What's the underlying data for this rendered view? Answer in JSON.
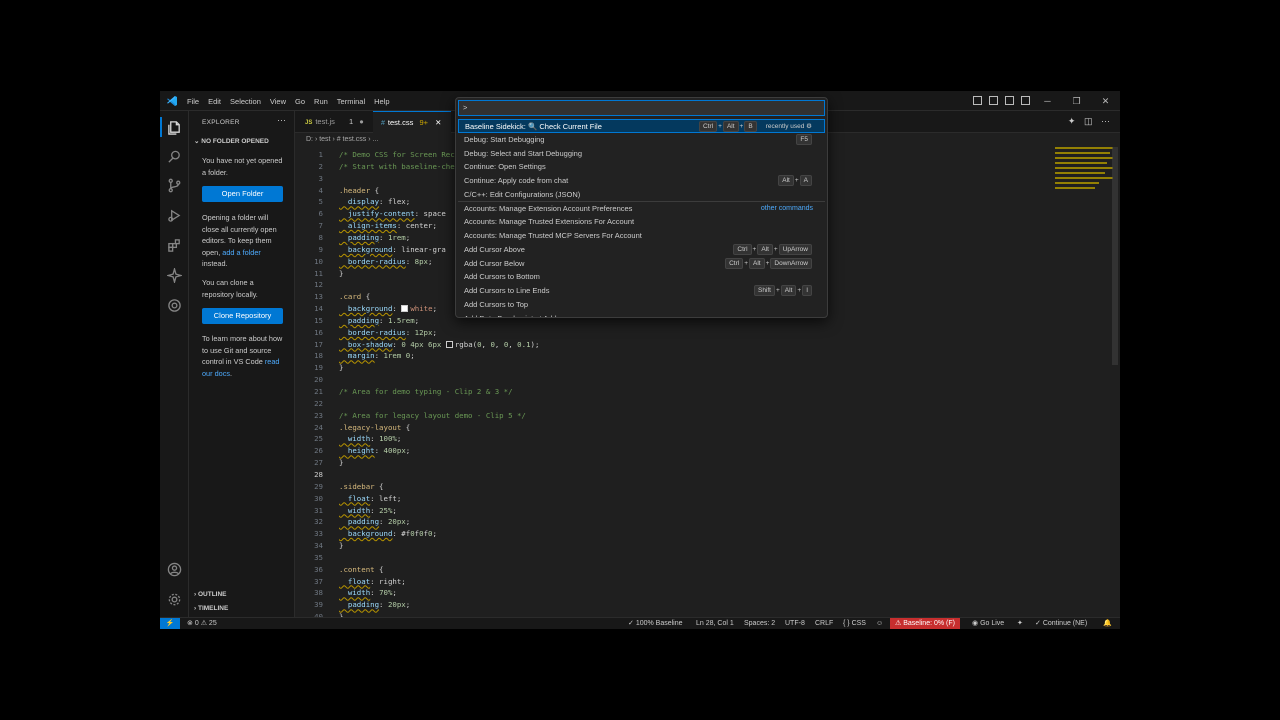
{
  "menu": [
    "File",
    "Edit",
    "Selection",
    "View",
    "Go",
    "Run",
    "Terminal",
    "Help"
  ],
  "sidebar": {
    "title": "EXPLORER",
    "section": "NO FOLDER OPENED",
    "msg1": "You have not yet opened a folder.",
    "open_folder": "Open Folder",
    "msg2_pre": "Opening a folder will close all currently open editors. To keep them open, ",
    "msg2_link": "add a folder",
    "msg2_post": " instead.",
    "msg3": "You can clone a repository locally.",
    "clone": "Clone Repository",
    "msg4_pre": "To learn more about how to use Git and source control in VS Code ",
    "msg4_link": "read our docs",
    "msg4_post": ".",
    "outline": "OUTLINE",
    "timeline": "TIMELINE"
  },
  "tabs": [
    {
      "icon": "JS",
      "name": "test.js",
      "badge": "1"
    },
    {
      "icon": "#",
      "name": "test.css",
      "badge": "9+"
    }
  ],
  "breadcrumb": "D: › test › # test.css › ...",
  "palette": {
    "input": ">",
    "items": [
      {
        "label": "Baseline Sidekick: 🔍 Check Current File",
        "keys": [
          "Ctrl",
          "+",
          "Alt",
          "+",
          "B"
        ],
        "right": "recently used"
      },
      {
        "label": "Debug: Start Debugging",
        "keys": [
          "F5"
        ]
      },
      {
        "label": "Debug: Select and Start Debugging"
      },
      {
        "label": "Continue: Open Settings"
      },
      {
        "label": "Continue: Apply code from chat",
        "keys": [
          "Alt",
          "+",
          "A"
        ]
      },
      {
        "label": "C/C++: Edit Configurations (JSON)"
      },
      {
        "label": "Accounts: Manage Extension Account Preferences",
        "link": "other commands"
      },
      {
        "label": "Accounts: Manage Trusted Extensions For Account"
      },
      {
        "label": "Accounts: Manage Trusted MCP Servers For Account"
      },
      {
        "label": "Add Cursor Above",
        "keys": [
          "Ctrl",
          "+",
          "Alt",
          "+",
          "UpArrow"
        ]
      },
      {
        "label": "Add Cursor Below",
        "keys": [
          "Ctrl",
          "+",
          "Alt",
          "+",
          "DownArrow"
        ]
      },
      {
        "label": "Add Cursors to Bottom"
      },
      {
        "label": "Add Cursors to Line Ends",
        "keys": [
          "Shift",
          "+",
          "Alt",
          "+",
          "I"
        ]
      },
      {
        "label": "Add Cursors to Top"
      },
      {
        "label": "Add Data Breakpoint at Address"
      }
    ]
  },
  "code": [
    "/* Demo CSS for Screen Recording",
    "/* Start with baseline-check",
    "",
    ".header {",
    "  display: flex;",
    "  justify-content: space",
    "  align-items: center;",
    "  padding: 1rem;",
    "  background: linear-gra",
    "  border-radius: 8px;",
    "}",
    "",
    ".card {",
    "  background: white;",
    "  padding: 1.5rem;",
    "  border-radius: 12px;",
    "  box-shadow: 0 4px 6px rgba(0, 0, 0, 0.1);",
    "  margin: 1rem 0;",
    "}",
    "",
    "/* Area for demo typing - Clip 2 & 3 */",
    "",
    "/* Area for legacy layout demo - Clip 5 */",
    ".legacy-layout {",
    "  width: 100%;",
    "  height: 400px;",
    "}",
    "",
    ".sidebar {",
    "  float: left;",
    "  width: 25%;",
    "  padding: 20px;",
    "  background: #f0f0f0;",
    "}",
    "",
    ".content {",
    "  float: right;",
    "  width: 70%;",
    "  padding: 20px;",
    "}"
  ],
  "status": {
    "problems": "0",
    "warnings": "25",
    "baseline_pct": "100% Baseline",
    "position": "Ln 28, Col 1",
    "spaces": "Spaces: 2",
    "encoding": "UTF-8",
    "eol": "CRLF",
    "language": "CSS",
    "baseline_alert": "Baseline: 0% (F)",
    "go_live": "Go Live",
    "continue": "Continue (NE)"
  },
  "colors": {
    "accent": "#0078d4",
    "selection": "#04395e",
    "error": "#c72e2e"
  }
}
